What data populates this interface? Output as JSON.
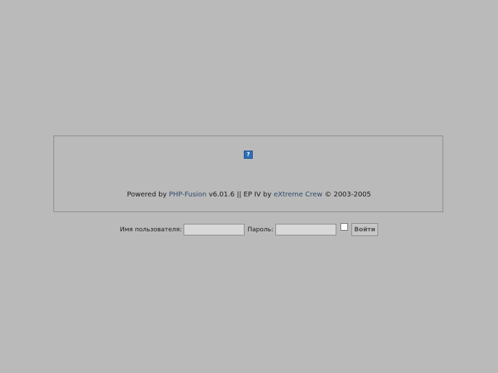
{
  "banner": {
    "image_icon": "broken-image-icon",
    "image_glyph": "?"
  },
  "footer": {
    "prefix": "Powered by ",
    "php_fusion_link": "PHP-Fusion",
    "version_text": " v6.01.6 || EP IV by ",
    "extreme_link": "eXtreme Crew",
    "copyright_text": " © 2003-2005"
  },
  "login": {
    "username_label": "Имя пользователя:",
    "username_value": "",
    "password_label": "Пароль:",
    "password_value": "",
    "remember_checked": false,
    "submit_label": "Войти"
  }
}
